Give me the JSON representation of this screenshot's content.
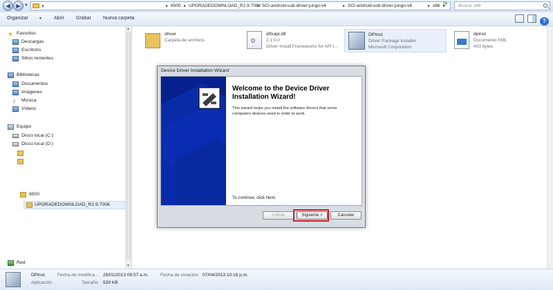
{
  "address": {
    "breadcrumbs": [
      "6500",
      "UPGRADEDOWNLOAD_R2.9.7006",
      "SCI-android-usb-driver-jungo-v4",
      "SCI-android-usb-driver-jungo-v4",
      "x86"
    ],
    "search_placeholder": "Buscar x86"
  },
  "toolbar": {
    "organize": "Organizar",
    "open": "Abrir",
    "burn": "Grabar",
    "new_folder": "Nueva carpeta"
  },
  "sidebar": {
    "favorites": "Favoritos",
    "downloads": "Descargas",
    "desktop": "Escritorio",
    "recent": "Sitios recientes",
    "libraries": "Bibliotecas",
    "documents": "Documentos",
    "images": "Imágenes",
    "music": "Música",
    "videos": "Vídeos",
    "computer": "Equipo",
    "disk_c": "Disco local (C:)",
    "disk_d": "Disco local (D:)",
    "folder_6500": "6500",
    "folder_upgraded": "UPGRADEDOWNLOAD_R2.9.7006",
    "network": "Red"
  },
  "files": [
    {
      "name": "driver",
      "line2": "Carpeta de archivos",
      "line3": ""
    },
    {
      "name": "difxapi.dll",
      "line2": "2.1.0.0",
      "line3": "Driver Install Frameworks for API l..."
    },
    {
      "name": "DPInst",
      "line2": "Driver Package Installer",
      "line3": "Microsoft Corporation"
    },
    {
      "name": "dpinst",
      "line2": "Documento XML",
      "line3": "403 bytes"
    }
  ],
  "wizard": {
    "title": "Device Driver Installation Wizard",
    "heading": "Welcome to the Device Driver Installation Wizard!",
    "description": "This wizard helps you install the software drivers that some computers devices need in order to work.",
    "continue_text": "To continue, click Next.",
    "back_label": "< Atrás",
    "next_label": "Siguiente >",
    "cancel_label": "Cancelar"
  },
  "details": {
    "name": "DPInst",
    "type": "Aplicación",
    "modified_label": "Fecha de modifica...",
    "modified_value": "25/01/2013 09:57 a.m.",
    "size_label": "Tamaño:",
    "size_value": "539 KB",
    "created_label": "Fecha de creación:",
    "created_value": "07/04/2013 10:16 p.m."
  },
  "colors": {
    "wizard_banner": "#06208e",
    "highlight": "#d21d23",
    "folder": "#e7c35e"
  }
}
